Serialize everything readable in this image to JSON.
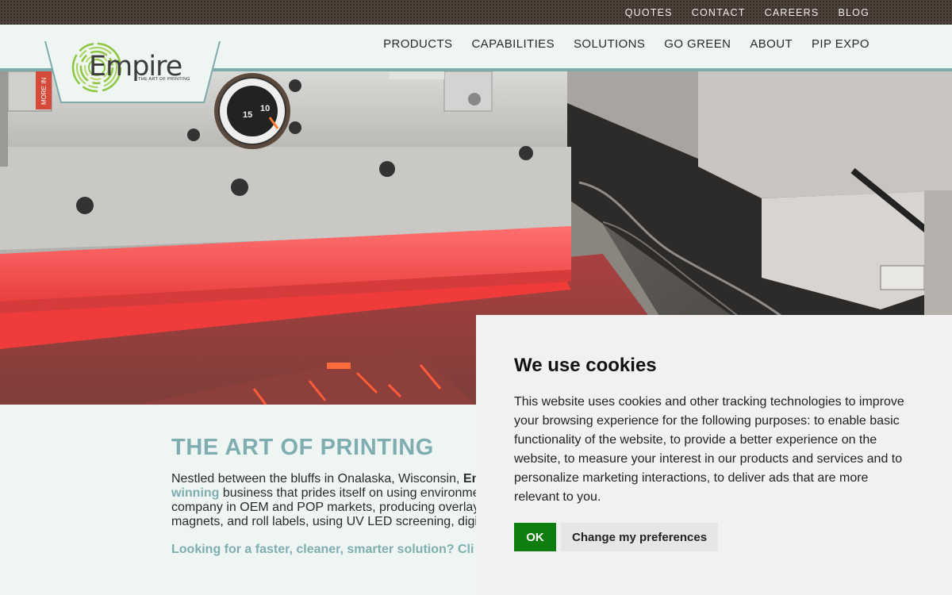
{
  "topbar": {
    "links": [
      "QUOTES",
      "CONTACT",
      "CAREERS",
      "BLOG"
    ]
  },
  "nav": {
    "items": [
      "PRODUCTS",
      "CAPABILITIES",
      "SOLUTIONS",
      "GO GREEN",
      "ABOUT",
      "PIP EXPO"
    ]
  },
  "logo": {
    "word": "Empire",
    "tagline": "THE ART OF PRINTING"
  },
  "hero": {
    "dial_labels": [
      "15",
      "10"
    ],
    "sticker_text": "MORE IN"
  },
  "content": {
    "heading": "THE ART OF PRINTING",
    "intro_start": "Nestled between the bluffs in Onalaska, Wisconsin, ",
    "intro_bold": "Em",
    "intro_link": "winning",
    "intro_rest_1": " business that prides itself on using environme",
    "intro_line_3": "company in OEM and POP markets, producing overlay",
    "intro_line_4": "magnets, and roll labels, using UV LED screening, digi",
    "cta": "Looking for a faster, cleaner, smarter solution? Cli"
  },
  "cookie": {
    "title": "We use cookies",
    "body": "This website uses cookies and other tracking technologies to improve your browsing experience for the following purposes: to enable basic functionality of the website, to provide a better experience on the website, to measure your interest in our products and services and to personalize marketing interactions, to deliver ads that are more relevant to you.",
    "ok_label": "OK",
    "pref_label": "Change my preferences"
  },
  "colors": {
    "topbar": "#4d4039",
    "accent_teal": "#7eaeb0",
    "ok_green": "#0f7d0f",
    "logo_green": "#8cc63f"
  }
}
